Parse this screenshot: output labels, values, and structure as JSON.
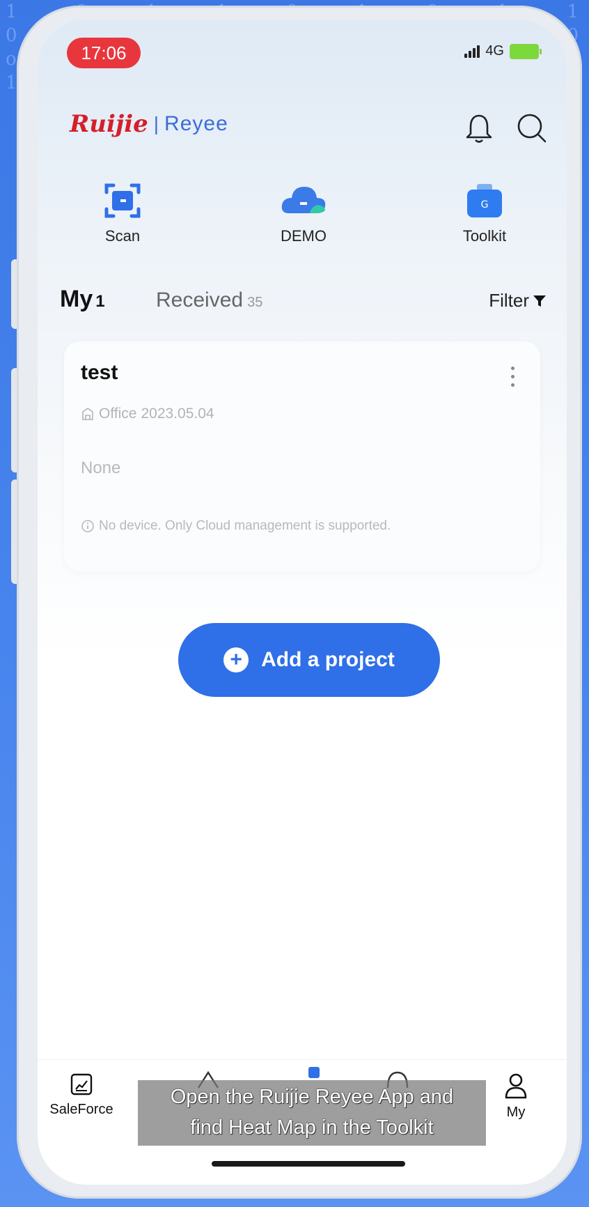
{
  "status": {
    "time": "17:06",
    "network": "4G"
  },
  "brand": {
    "ruijie": "Ruijie",
    "separator": "|",
    "reyee": "Reyee"
  },
  "quick_actions": [
    {
      "label": "Scan",
      "icon": "scan-icon"
    },
    {
      "label": "DEMO",
      "icon": "cloud-icon"
    },
    {
      "label": "Toolkit",
      "icon": "toolkit-icon"
    }
  ],
  "tabs": {
    "my": {
      "label": "My",
      "count": "1"
    },
    "received": {
      "label": "Received",
      "count": "35"
    },
    "filter_label": "Filter"
  },
  "project_card": {
    "title": "test",
    "type": "Office",
    "date": "2023.05.04",
    "description": "None",
    "note": "No device. Only Cloud management is supported."
  },
  "add_button": {
    "label": "Add a project"
  },
  "tabbar": {
    "saleforce": "SaleForce",
    "my": "My"
  },
  "subtitle": {
    "line1": "Open the Ruijie Reyee App and",
    "line2": "find Heat Map in the Toolkit"
  },
  "colors": {
    "accent": "#2f6fe8",
    "brand_red": "#d3202a",
    "brand_blue": "#3b6dd6",
    "time_pill": "#e8363d"
  }
}
